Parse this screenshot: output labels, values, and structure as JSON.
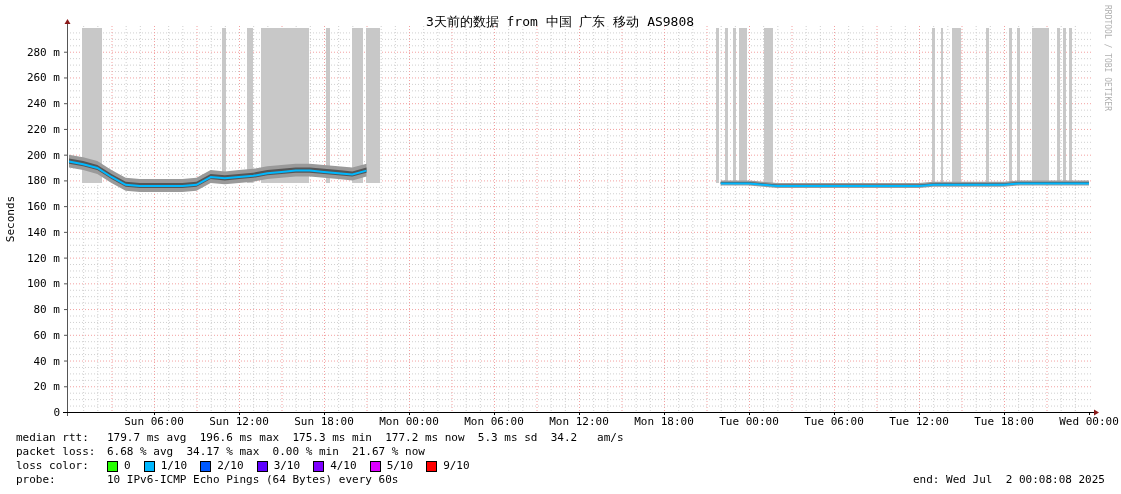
{
  "title": "3天前的数据 from 中国 广东 移动 AS9808",
  "credit": "RRDTOOL / TOBI OETIKER",
  "chart_data": {
    "type": "line",
    "grid": true,
    "ylabel": "Seconds",
    "ylim": [
      0,
      300
    ],
    "categories": [
      null,
      null,
      null,
      null,
      null,
      null,
      "Sun 06:00",
      null,
      null,
      null,
      null,
      null,
      "Sun 12:00",
      null,
      null,
      null,
      null,
      null,
      "Sun 18:00",
      null,
      null,
      null,
      null,
      null,
      "Mon 00:00",
      null,
      null,
      null,
      null,
      null,
      "Mon 06:00",
      null,
      null,
      null,
      null,
      null,
      "Mon 12:00",
      null,
      null,
      null,
      null,
      null,
      "Mon 18:00",
      null,
      null,
      null,
      null,
      null,
      "Tue 00:00",
      null,
      null,
      null,
      null,
      null,
      "Tue 06:00",
      null,
      null,
      null,
      null,
      null,
      "Tue 12:00",
      null,
      null,
      null,
      null,
      null,
      "Tue 18:00",
      null,
      null,
      null,
      null,
      null,
      "Wed 00:00"
    ],
    "yticks": [
      {
        "value": 0,
        "label": "0"
      },
      {
        "value": 20,
        "label": "20 m"
      },
      {
        "value": 40,
        "label": "40 m"
      },
      {
        "value": 60,
        "label": "60 m"
      },
      {
        "value": 80,
        "label": "80 m"
      },
      {
        "value": 100,
        "label": "100 m"
      },
      {
        "value": 120,
        "label": "120 m"
      },
      {
        "value": 140,
        "label": "140 m"
      },
      {
        "value": 160,
        "label": "160 m"
      },
      {
        "value": 180,
        "label": "180 m"
      },
      {
        "value": 200,
        "label": "200 m"
      },
      {
        "value": 220,
        "label": "220 m"
      },
      {
        "value": 240,
        "label": "240 m"
      },
      {
        "value": 260,
        "label": "260 m"
      },
      {
        "value": 280,
        "label": "280 m"
      }
    ],
    "series": [
      {
        "color": "#00b8ff",
        "values": [
          195,
          193,
          190,
          183,
          177,
          176,
          176,
          176,
          176,
          177,
          183,
          182,
          183,
          184,
          186,
          187,
          188,
          188,
          187,
          186,
          185,
          188,
          null,
          null,
          null,
          null,
          null,
          null,
          null,
          null,
          null,
          null,
          null,
          null,
          null,
          null,
          null,
          null,
          null,
          null,
          null,
          null,
          null,
          null,
          null,
          null,
          178,
          178,
          178,
          177,
          176,
          176,
          176,
          176,
          176,
          176,
          176,
          176,
          176,
          176,
          176,
          177,
          177,
          177,
          177,
          177,
          177,
          178,
          178,
          178,
          178,
          178,
          178
        ]
      }
    ]
  },
  "legend": {
    "median_rtt": {
      "label": "median rtt:",
      "text": "179.7 ms avg  196.6 ms max  175.3 ms min  177.2 ms now  5.3 ms sd  34.2   am/s"
    },
    "packet_loss": {
      "label": "packet loss:",
      "text": "6.68 % avg  34.17 % max  0.00 % min  21.67 % now"
    },
    "loss_color": {
      "label": "loss color:",
      "items": [
        {
          "label": "0",
          "color": "#26ff00"
        },
        {
          "label": "1/10",
          "color": "#00b8ff"
        },
        {
          "label": "2/10",
          "color": "#0059ff"
        },
        {
          "label": "3/10",
          "color": "#5e00ff"
        },
        {
          "label": "4/10",
          "color": "#7e00ff"
        },
        {
          "label": "5/10",
          "color": "#dd00ff"
        },
        {
          "label": "9/10",
          "color": "#ff0000"
        }
      ]
    },
    "probe": {
      "label": "probe:",
      "text": "10 IPv6-ICMP Echo Pings (64 Bytes) every 60s"
    },
    "end": "end: Wed Jul  2 00:08:08 2025"
  }
}
